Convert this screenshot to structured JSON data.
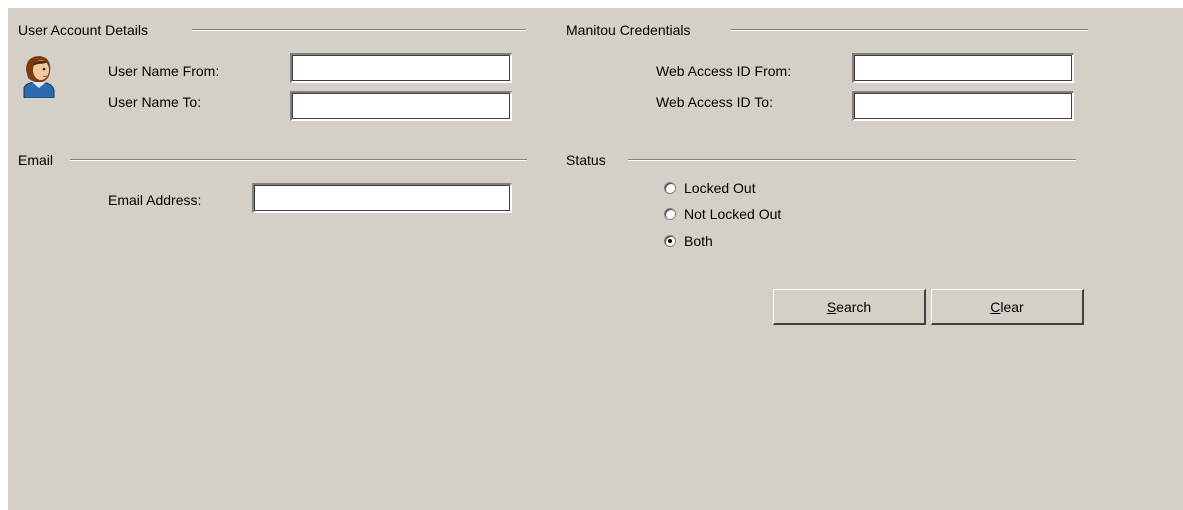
{
  "user_account": {
    "title": "User Account Details",
    "user_name_from_label": "User Name From:",
    "user_name_to_label": "User Name To:",
    "user_name_from_value": "",
    "user_name_to_value": ""
  },
  "manitou": {
    "title": "Manitou Credentials",
    "web_access_from_label": "Web Access ID From:",
    "web_access_to_label": "Web Access ID To:",
    "web_access_from_value": "",
    "web_access_to_value": ""
  },
  "email": {
    "title": "Email",
    "address_label": "Email Address:",
    "address_value": ""
  },
  "status": {
    "title": "Status",
    "options": [
      "Locked Out",
      "Not Locked Out",
      "Both"
    ],
    "selected": "Both"
  },
  "buttons": {
    "search_accel": "S",
    "search_rest": "earch",
    "clear_accel": "C",
    "clear_rest": "lear"
  },
  "icons": {
    "user": "user-avatar-icon"
  }
}
